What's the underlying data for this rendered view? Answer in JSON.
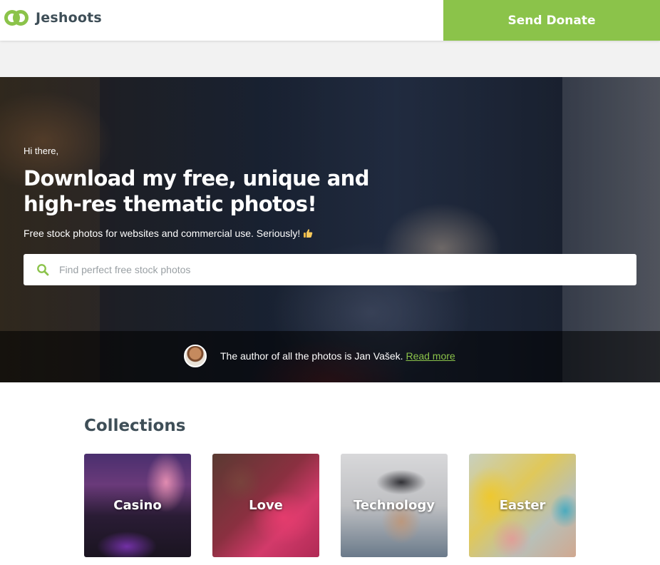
{
  "header": {
    "logo_text": "Jeshoots",
    "donate_label": "Send Donate"
  },
  "hero": {
    "greeting": "Hi there,",
    "headline_line1": "Download my free, unique and",
    "headline_line2": "high-res thematic photos!",
    "subline": "Free stock photos for websites and commercial use. Seriously!",
    "subline_icon": "thumbs-up-icon"
  },
  "search": {
    "placeholder": "Find perfect free stock photos",
    "value": ""
  },
  "author": {
    "text": "The author of all the photos is Jan Vašek.",
    "link_label": "Read more"
  },
  "collections": {
    "title": "Collections",
    "items": [
      {
        "label": "Casino"
      },
      {
        "label": "Love"
      },
      {
        "label": "Technology"
      },
      {
        "label": "Easter"
      }
    ]
  },
  "colors": {
    "accent": "#8bc34a",
    "heading": "#3e4e57",
    "band": "#f2f2f2"
  }
}
